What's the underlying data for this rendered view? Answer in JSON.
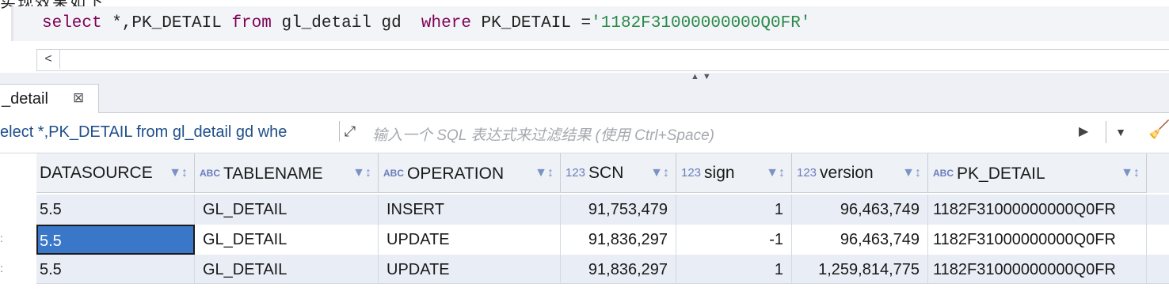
{
  "heading_cut": "实现效果如下",
  "editor": {
    "sql_select": "select",
    "sql_part1": " *,PK_DETAIL ",
    "sql_from": "from",
    "sql_part2": " gl_detail gd  ",
    "sql_where": "where",
    "sql_part3": " PK_DETAIL =",
    "sql_string": "'1182F31000000000Q0FR'",
    "scroll_left": "<"
  },
  "sash": {
    "arrows": "▲▼"
  },
  "tab": {
    "label": "_detail",
    "close": "⊠"
  },
  "filter": {
    "query": "elect *,PK_DETAIL from gl_detail gd whe",
    "expand_icon": "⤢",
    "placeholder": "输入一个 SQL 表达式来过滤结果 (使用 Ctrl+Space)",
    "run_icon": "▶",
    "history_icon": "▼",
    "erase_icon": "🧹"
  },
  "grid": {
    "columns": [
      {
        "type": "",
        "name": "DATASOURCE"
      },
      {
        "type": "ABC",
        "name": "TABLENAME"
      },
      {
        "type": "ABC",
        "name": "OPERATION"
      },
      {
        "type": "123",
        "name": "SCN"
      },
      {
        "type": "123",
        "name": "sign"
      },
      {
        "type": "123",
        "name": "version"
      },
      {
        "type": "ABC",
        "name": "PK_DETAIL"
      }
    ],
    "control_icon": "▼↕",
    "rows": [
      {
        "datasource": "5.5",
        "tablename": "GL_DETAIL",
        "operation": "INSERT",
        "scn": "91,753,479",
        "sign": "1",
        "version": "96,463,749",
        "pk_detail": "1182F31000000000Q0FR"
      },
      {
        "datasource": "5.5",
        "tablename": "GL_DETAIL",
        "operation": "UPDATE",
        "scn": "91,836,297",
        "sign": "-1",
        "version": "96,463,749",
        "pk_detail": "1182F31000000000Q0FR"
      },
      {
        "datasource": "5.5",
        "tablename": "GL_DETAIL",
        "operation": "UPDATE",
        "scn": "91,836,297",
        "sign": "1",
        "version": "1,259,814,775",
        "pk_detail": "1182F31000000000Q0FR"
      }
    ]
  },
  "colors": {
    "selection": "#3b77c8",
    "keyword": "#7f0055",
    "string": "#2a8a4a"
  }
}
